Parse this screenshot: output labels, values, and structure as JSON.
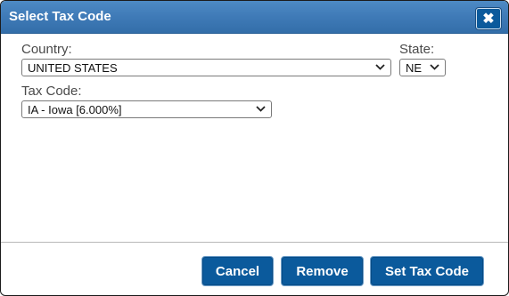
{
  "dialog": {
    "title": "Select Tax Code",
    "close_icon": "close-icon",
    "close_glyph": "✖"
  },
  "form": {
    "country_label": "Country:",
    "country_value": "UNITED STATES",
    "state_label": "State:",
    "state_value": "NE",
    "tax_code_label": "Tax Code:",
    "tax_code_value": "IA - Iowa [6.000%]"
  },
  "footer": {
    "cancel_label": "Cancel",
    "remove_label": "Remove",
    "set_label": "Set Tax Code"
  },
  "colors": {
    "titlebar": "#3f7ab7",
    "button": "#0b5a9c"
  }
}
